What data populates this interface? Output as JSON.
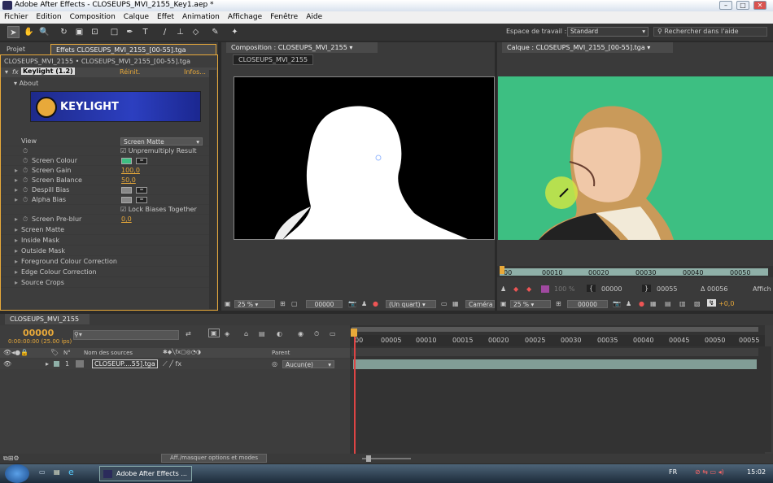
{
  "window": {
    "title": "Adobe After Effects - CLOSEUPS_MVI_2155_Key1.aep *"
  },
  "menu": [
    "Fichier",
    "Edition",
    "Composition",
    "Calque",
    "Effet",
    "Animation",
    "Affichage",
    "Fenêtre",
    "Aide"
  ],
  "workspace": {
    "label": "Espace de travail :",
    "value": "Standard",
    "search_placeholder": "Rechercher dans l'aide"
  },
  "effects_panel": {
    "tab_project": "Projet",
    "tab_effects": "Effets CLOSEUPS_MVI_2155_[00-55].tga",
    "subtitle": "CLOSEUPS_MVI_2155 • CLOSEUPS_MVI_2155_[00-55].tga",
    "effect_name": "Keylight (1.2)",
    "reset": "Réinit.",
    "info": "Infos...",
    "about": "About",
    "logo_text": "KEYLIGHT",
    "view_label": "View",
    "view_value": "Screen Matte",
    "unpremultiply": "Unpremultiply Result",
    "screen_colour": "Screen Colour",
    "screen_colour_hex": "#3dbf82",
    "screen_gain": "Screen Gain",
    "screen_gain_val": "100,0",
    "screen_balance": "Screen Balance",
    "screen_balance_val": "50,0",
    "despill_bias": "Despill Bias",
    "alpha_bias": "Alpha Bias",
    "lock_biases": "Lock Biases Together",
    "screen_preblur": "Screen Pre-blur",
    "screen_preblur_val": "0,0",
    "groups": [
      "Screen Matte",
      "Inside Mask",
      "Outside Mask",
      "Foreground Colour Correction",
      "Edge Colour Correction",
      "Source Crops"
    ]
  },
  "comp_panel": {
    "tab": "Composition : CLOSEUPS_MVI_2155",
    "subtab": "CLOSEUPS_MVI_2155",
    "zoom": "25 %",
    "time": "00000",
    "res": "(Un quart)",
    "camera": "Caméra"
  },
  "layer_panel": {
    "tab": "Calque : CLOSEUPS_MVI_2155_[00-55].tga",
    "ruler": [
      "00",
      "00010",
      "00020",
      "00030",
      "00040",
      "00050"
    ],
    "in": "00000",
    "out": "00055",
    "duration": "Δ 00056",
    "zoom": "25 %",
    "time": "00000",
    "show": "Affich",
    "offset": "+0,0",
    "opacity": "100 %"
  },
  "timeline": {
    "tab": "CLOSEUPS_MVI_2155",
    "timecode": "00000",
    "timecode_sub": "0:00:00:00 (25.00 ips)",
    "search_placeholder": "",
    "col_num": "N°",
    "col_source": "Nom des sources",
    "col_parent": "Parent",
    "ruler": [
      "00",
      "00005",
      "00010",
      "00015",
      "00020",
      "00025",
      "00030",
      "00035",
      "00040",
      "00045",
      "00050",
      "00055"
    ],
    "layer_num": "1",
    "layer_name": "CLOSEUP....55].tga",
    "layer_parent": "Aucun(e)",
    "toggle_label": "Aff./masquer options et modes"
  },
  "taskbar": {
    "app": "Adobe After Effects ...",
    "lang": "FR",
    "clock": "15:02"
  }
}
